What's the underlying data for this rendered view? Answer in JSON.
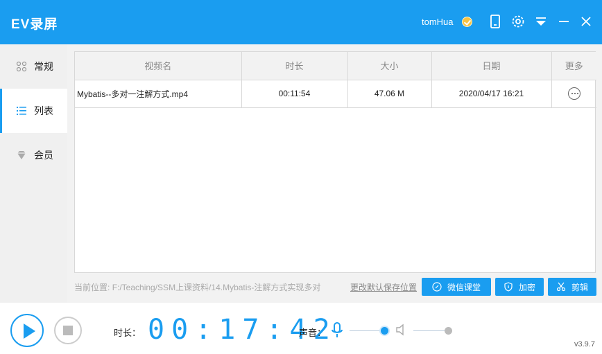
{
  "app": {
    "title": "EV录屏",
    "user": "tomHua",
    "version": "v3.9.7"
  },
  "titlebar": {
    "icons": [
      "vip-badge-icon",
      "tablet-icon",
      "settings-gear-icon",
      "dropdown-menu-icon",
      "minimize-icon",
      "close-icon"
    ]
  },
  "sidebar": {
    "items": [
      {
        "label": "常规",
        "icon": "grid-icon",
        "active": false
      },
      {
        "label": "列表",
        "icon": "list-icon",
        "active": true
      },
      {
        "label": "会员",
        "icon": "diamond-icon",
        "active": false
      }
    ]
  },
  "table": {
    "headers": [
      "视频名",
      "时长",
      "大小",
      "日期",
      "更多"
    ],
    "rows": [
      {
        "name": "Mybatis--多对一注解方式.mp4",
        "duration": "00:11:54",
        "size": "47.06 M",
        "date": "2020/04/17 16:21"
      }
    ]
  },
  "path": {
    "label": "当前位置:",
    "value": "F:/Teaching/SSM上课资料/14.Mybatis-注解方式实现多对",
    "change_link": "更改默认保存位置"
  },
  "buttons": {
    "classroom": "微信课堂",
    "encrypt": "加密",
    "cut": "剪辑"
  },
  "bottom": {
    "duration_label": "时长：",
    "timer": "00:17:42",
    "volume_label": "声音：",
    "mic_level": 1.0,
    "speaker_level": 1.0
  },
  "colors": {
    "accent": "#1a9df0",
    "inactive_knob": "#bbbbbb"
  }
}
